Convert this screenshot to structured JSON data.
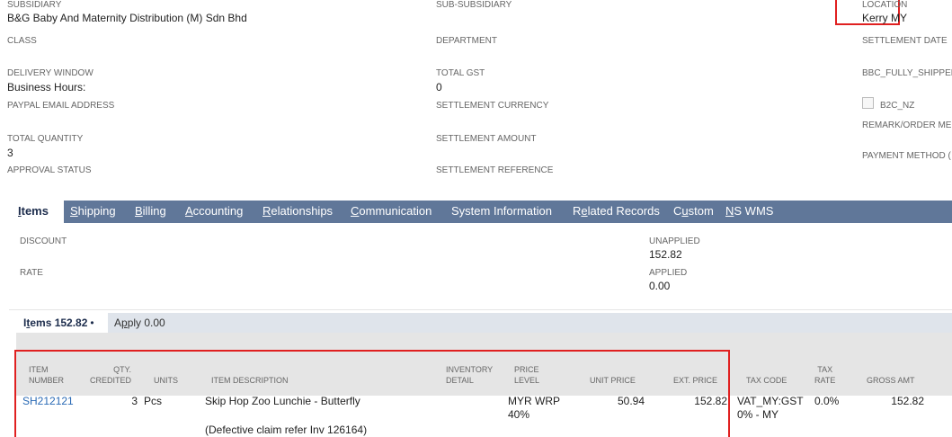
{
  "header_fields": {
    "subsidiary": {
      "label": "SUBSIDIARY",
      "value": "B&G Baby And Maternity Distribution (M) Sdn Bhd"
    },
    "sub_subsidiary": {
      "label": "SUB-SUBSIDIARY"
    },
    "location": {
      "label": "LOCATION",
      "value": "Kerry MY"
    },
    "class": {
      "label": "CLASS"
    },
    "department": {
      "label": "DEPARTMENT"
    },
    "settlement_date": {
      "label": "SETTLEMENT DATE"
    },
    "delivery_window": {
      "label": "DELIVERY WINDOW",
      "value": "Business Hours:"
    },
    "total_gst": {
      "label": "TOTAL GST",
      "value": "0"
    },
    "bbc_fully_shipped": {
      "label": "BBC_FULLY_SHIPPED"
    },
    "paypal_email": {
      "label": "PAYPAL EMAIL ADDRESS"
    },
    "settlement_currency": {
      "label": "SETTLEMENT CURRENCY"
    },
    "b2c_nz": {
      "label": "B2C_NZ",
      "checked": false
    },
    "remark_order": {
      "label": "REMARK/ORDER ME"
    },
    "total_quantity": {
      "label": "TOTAL QUANTITY",
      "value": "3"
    },
    "settlement_amount": {
      "label": "SETTLEMENT AMOUNT"
    },
    "payment_method": {
      "label": "PAYMENT METHOD ("
    },
    "approval_status": {
      "label": "APPROVAL STATUS"
    },
    "settlement_reference": {
      "label": "SETTLEMENT REFERENCE"
    }
  },
  "tabs": [
    {
      "first": "I",
      "rest": "tems",
      "active": true
    },
    {
      "first": "S",
      "rest": "hipping"
    },
    {
      "first": "B",
      "rest": "illing"
    },
    {
      "first": "A",
      "rest": "ccounting"
    },
    {
      "first": "R",
      "rest": "elationships"
    },
    {
      "first": "C",
      "rest": "ommunication"
    },
    {
      "first": "",
      "rest": "System Information"
    },
    {
      "pre": "R",
      "first": "e",
      "rest": "lated Records"
    },
    {
      "pre": "C",
      "first": "u",
      "rest": "stom"
    },
    {
      "first": "N",
      "rest": "S WMS"
    }
  ],
  "items_panel": {
    "discount_label": "DISCOUNT",
    "rate_label": "RATE",
    "unapplied_label": "UNAPPLIED",
    "unapplied_value": "152.82",
    "applied_label": "APPLIED",
    "applied_value": "0.00"
  },
  "subtabs": {
    "items_first": "I",
    "items_u": "t",
    "items_rest": "ems 152.82",
    "items_bullet": "•",
    "apply_first": "A",
    "apply_u": "p",
    "apply_rest": "ply 0.00"
  },
  "columns": {
    "item_number": [
      "ITEM",
      "NUMBER"
    ],
    "qty_credited": [
      "QTY.",
      "CREDITED"
    ],
    "units": "UNITS",
    "item_description": "ITEM DESCRIPTION",
    "inventory_detail": [
      "INVENTORY",
      "DETAIL"
    ],
    "price_level": [
      "PRICE",
      "LEVEL"
    ],
    "unit_price": "UNIT PRICE",
    "ext_price": "EXT. PRICE",
    "tax_code": "TAX CODE",
    "tax_rate": [
      "TAX",
      "RATE"
    ],
    "gross_amt": "GROSS AMT"
  },
  "row": {
    "item_number": "SH212121",
    "qty": "3",
    "units": "Pcs",
    "description": "Skip Hop Zoo Lunchie - Butterfly",
    "description_note": "(Defective claim refer Inv 126164)",
    "price_level": [
      "MYR WRP",
      "40%"
    ],
    "unit_price": "50.94",
    "ext_price": "152.82",
    "tax_code": [
      "VAT_MY:GST",
      "0% - MY"
    ],
    "tax_rate": "0.0%",
    "gross_amt": "152.82"
  },
  "colors": {
    "tab_bar": "#607799",
    "highlight": "#e02020",
    "link": "#2a6ab5"
  }
}
